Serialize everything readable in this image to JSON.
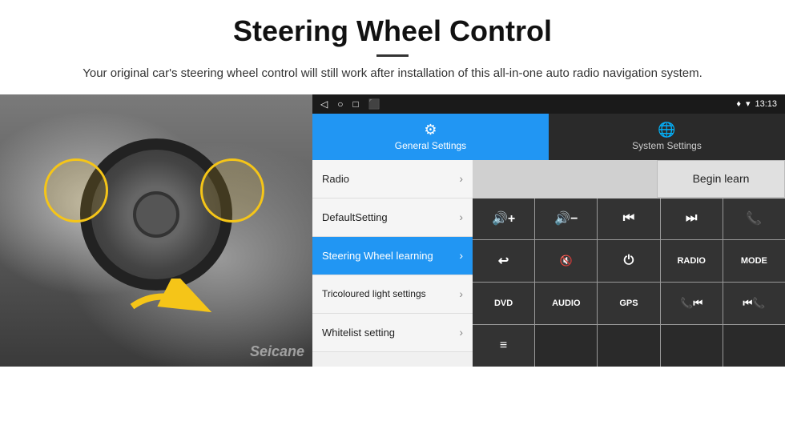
{
  "header": {
    "title": "Steering Wheel Control",
    "description": "Your original car's steering wheel control will still work after installation of this all-in-one auto radio navigation system."
  },
  "statusBar": {
    "time": "13:13",
    "icons": [
      "◁",
      "○",
      "□",
      "⬛"
    ]
  },
  "tabs": [
    {
      "id": "general",
      "label": "General Settings",
      "icon": "⚙",
      "active": true
    },
    {
      "id": "system",
      "label": "System Settings",
      "icon": "🌐",
      "active": false
    }
  ],
  "menuItems": [
    {
      "label": "Radio",
      "active": false
    },
    {
      "label": "DefaultSetting",
      "active": false
    },
    {
      "label": "Steering Wheel learning",
      "active": true
    },
    {
      "label": "Tricoloured light settings",
      "active": false
    },
    {
      "label": "Whitelist setting",
      "active": false
    }
  ],
  "beginLearnLabel": "Begin learn",
  "buttons": [
    {
      "label": "🔊+",
      "row": 1
    },
    {
      "label": "🔊−",
      "row": 1
    },
    {
      "label": "⏮",
      "row": 1
    },
    {
      "label": "⏭",
      "row": 1
    },
    {
      "label": "📞",
      "row": 1
    },
    {
      "label": "↩",
      "row": 2
    },
    {
      "label": "🔇",
      "row": 2
    },
    {
      "label": "⏻",
      "row": 2
    },
    {
      "label": "RADIO",
      "row": 2
    },
    {
      "label": "MODE",
      "row": 2
    },
    {
      "label": "DVD",
      "row": 3
    },
    {
      "label": "AUDIO",
      "row": 3
    },
    {
      "label": "GPS",
      "row": 3
    },
    {
      "label": "📞⏮",
      "row": 3
    },
    {
      "label": "⏮📞",
      "row": 3
    },
    {
      "label": "≡",
      "row": 4
    }
  ],
  "watermark": "Seicane"
}
